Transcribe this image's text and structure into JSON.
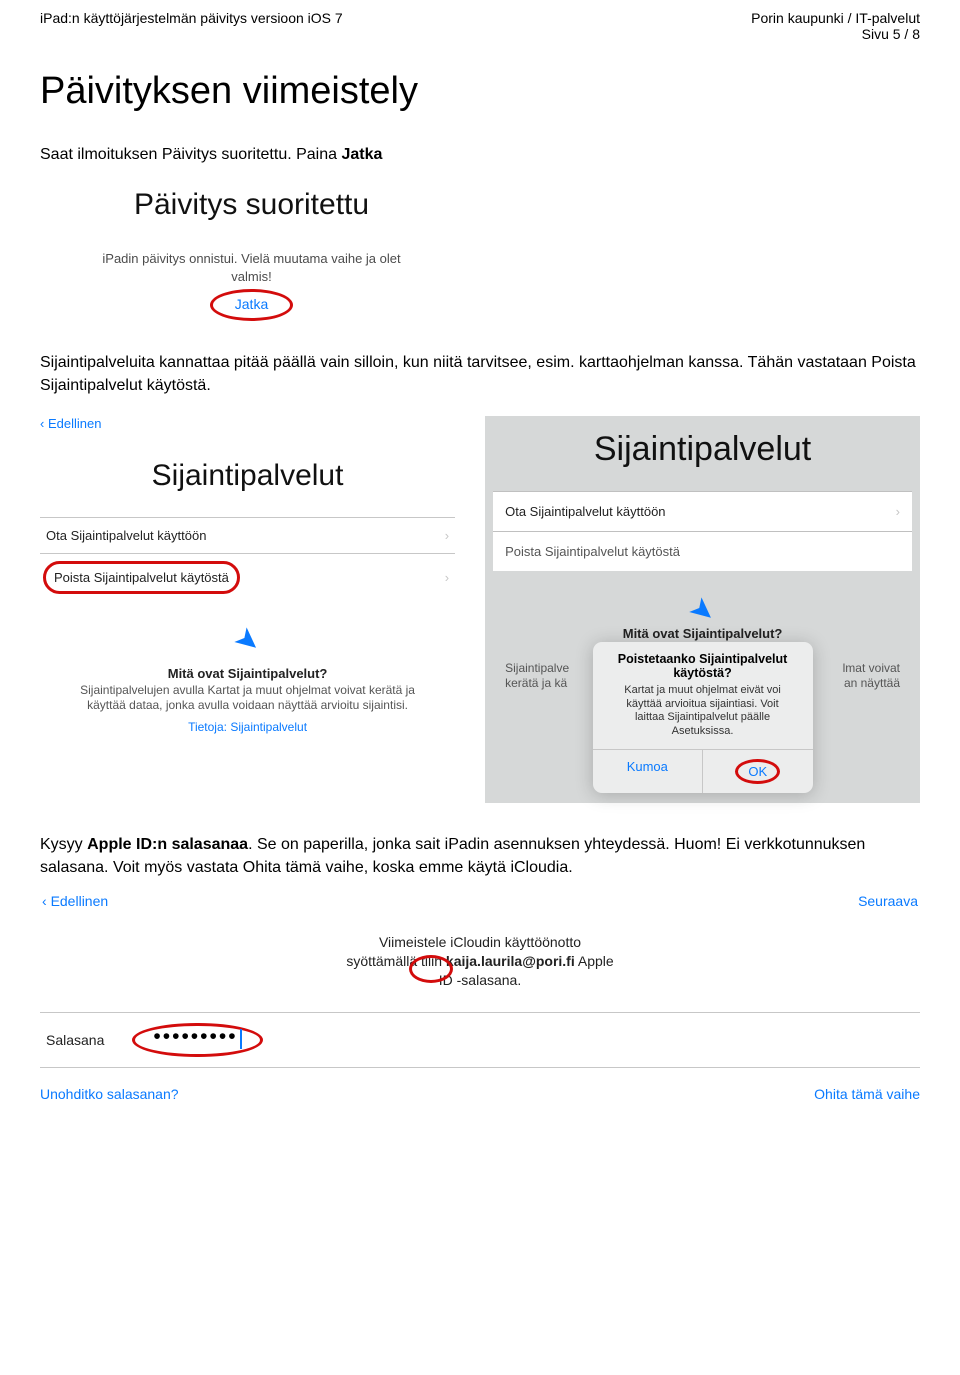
{
  "header": {
    "left": "iPad:n käyttöjärjestelmän päivitys versioon iOS 7",
    "right_line1": "Porin kaupunki / IT-palvelut",
    "right_line2": "Sivu 5 / 8"
  },
  "section_title": "Päivityksen viimeistely",
  "intro": {
    "part1": "Saat ilmoituksen Päivitys suoritettu. Paina ",
    "bold": "Jatka"
  },
  "shot1": {
    "title": "Päivitys suoritettu",
    "line1": "iPadin päivitys onnistui. Vielä muutama vaihe ja olet",
    "line2": "valmis!",
    "button": "Jatka"
  },
  "para2": "Sijaintipalveluita kannattaa pitää päällä vain silloin, kun niitä tarvitsee, esim. karttaohjelman kanssa. Tähän vastataan Poista Sijaintipalvelut käytöstä.",
  "left": {
    "back": "Edellinen",
    "title": "Sijaintipalvelut",
    "opt1": "Ota Sijaintipalvelut käyttöön",
    "opt2": "Poista Sijaintipalvelut käytöstä",
    "q_title": "Mitä ovat Sijaintipalvelut?",
    "q_body": "Sijaintipalvelujen avulla Kartat ja muut ohjelmat voivat kerätä ja käyttää dataa, jonka avulla voidaan näyttää arvioitu sijaintisi.",
    "q_link": "Tietoja: Sijaintipalvelut"
  },
  "right": {
    "title": "Sijaintipalvelut",
    "opt1": "Ota Sijaintipalvelut käyttöön",
    "opt2": "Poista Sijaintipalvelut käytöstä",
    "q_title": "Mitä ovat Sijaintipalvelut?",
    "descr_left": "Sijaintipalve",
    "descr_right": "lmat voivat",
    "descr2_left": "kerätä ja kä",
    "descr2_right": "an näyttää",
    "dialog_title": "Poistetaanko Sijaintipalvelut käytöstä?",
    "dialog_body": "Kartat ja muut ohjelmat eivät voi käyttää arvioitua sijaintiasi. Voit laittaa Sijaintipalvelut päälle Asetuksissa.",
    "btn_cancel": "Kumoa",
    "btn_ok": "OK"
  },
  "para3": {
    "part1": "Kysyy ",
    "bold1": "Apple ID:n salasanaa",
    "part2": ". Se on paperilla, jonka sait iPadin asennuksen yhteydessä. Huom! Ei verkkotunnuksen salasana. Voit myös vastata Ohita tämä vaihe, koska emme käytä iCloudia."
  },
  "shot4": {
    "back": "Edellinen",
    "next": "Seuraava",
    "center1": "Viimeistele iCloudin käyttöönotto",
    "center2_pre": "syöttämällä tilin ",
    "center2_bold": "kaija.laurila@pori.fi",
    "center2_post": " Apple",
    "center3": "ID -salasana.",
    "pw_label": "Salasana",
    "forgot": "Unohditko salasanan?",
    "skip": "Ohita tämä vaihe"
  }
}
